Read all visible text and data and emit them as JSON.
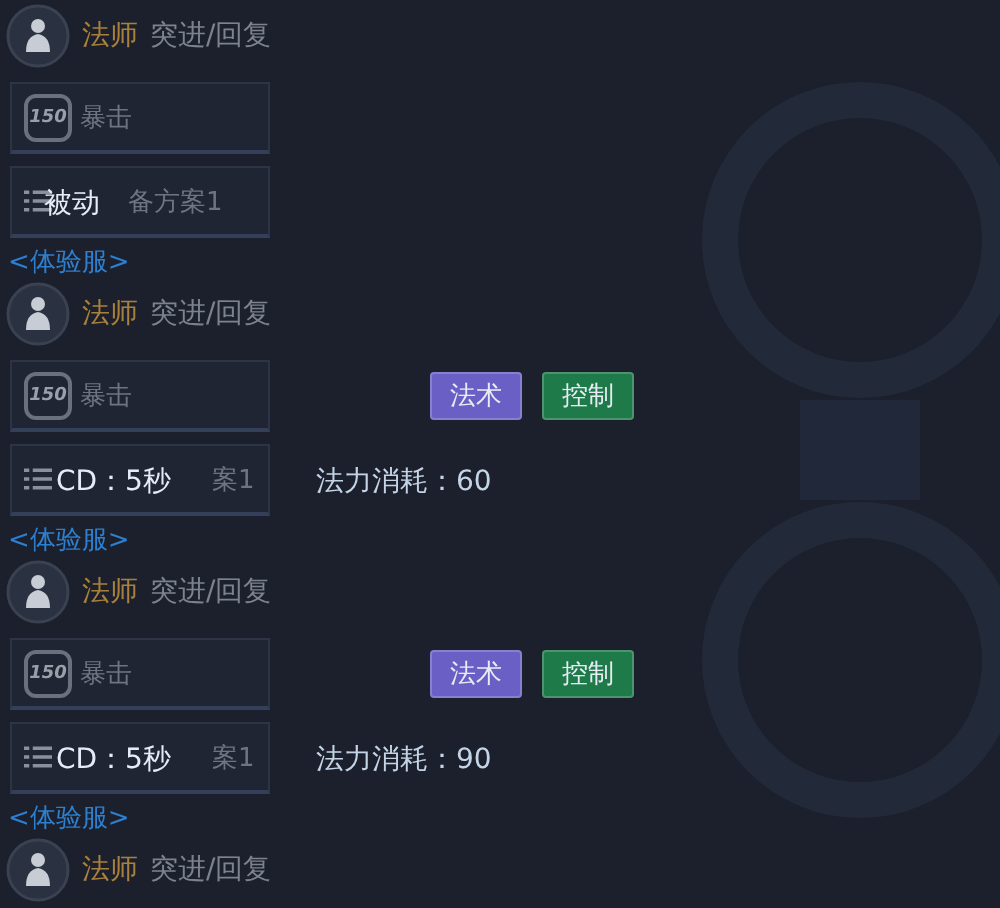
{
  "blocks": [
    {
      "header": {
        "role": "法师",
        "traits": "突进/回复"
      },
      "crit": {
        "badge": "150",
        "label": "暴击"
      },
      "scheme": {
        "label": "备方案1"
      },
      "overlay": {
        "passive": "被动"
      },
      "server": "<体验服>"
    },
    {
      "header": {
        "role": "法师",
        "traits": "突进/回复"
      },
      "crit": {
        "badge": "150",
        "label": "暴击"
      },
      "skill_tags": [
        {
          "label": "法术",
          "color": "#6a5fc4"
        },
        {
          "label": "控制",
          "color": "#1f7a4a"
        }
      ],
      "scheme": {
        "label": "案1"
      },
      "overlay": {
        "cd": "CD：5秒",
        "cost": "法力消耗：60"
      },
      "server": "<体验服>"
    },
    {
      "header": {
        "role": "法师",
        "traits": "突进/回复"
      },
      "crit": {
        "badge": "150",
        "label": "暴击"
      },
      "skill_tags": [
        {
          "label": "法术",
          "color": "#6a5fc4"
        },
        {
          "label": "控制",
          "color": "#1f7a4a"
        }
      ],
      "scheme": {
        "label": "案1"
      },
      "overlay": {
        "cd": "CD：5秒",
        "cost": "法力消耗：90"
      },
      "server": "<体验服>"
    },
    {
      "header": {
        "role": "法师",
        "traits": "突进/回复"
      }
    }
  ]
}
